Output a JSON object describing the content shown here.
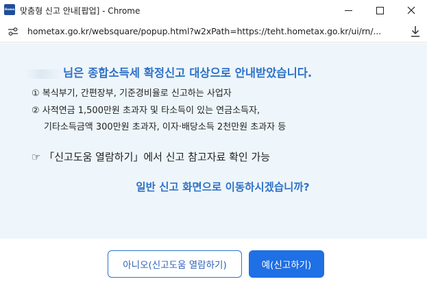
{
  "window": {
    "title": "맞춤형 신고 안내[팝업] - Chrome",
    "app_icon_text": "Home"
  },
  "addressbar": {
    "url": "hometax.go.kr/websquare/popup.html?w2xPath=https://teht.hometax.go.kr/ui/rn/..."
  },
  "popup": {
    "headline_suffix": "님은 종합소득세 확정신고 대상으로 안내받았습니다.",
    "items": [
      "① 복식부기, 간편장부, 기준경비율로 신고하는 사업자",
      "② 사적연금 1,500만원 초과자 및 타소득이 있는 연금소득자,",
      "기타소득금액 300만원 초과자, 이자·배당소득 2천만원 초과자 등"
    ],
    "guide": "☞ 「신고도움 열람하기」에서 신고 참고자료 확인 가능",
    "question": "일반 신고 화면으로 이동하시겠습니까?"
  },
  "buttons": {
    "no_label": "아니오(신고도움 열람하기)",
    "yes_label": "예(신고하기)"
  },
  "colors": {
    "accent": "#2f72c6",
    "primary_button": "#1f6fe5",
    "content_bg": "#eef6fb"
  }
}
